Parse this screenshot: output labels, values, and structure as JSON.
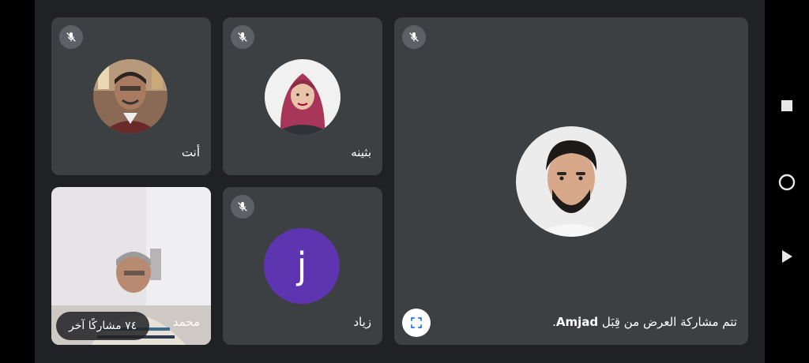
{
  "tiles": {
    "you": {
      "name": "أنت",
      "muted": true
    },
    "bothaina": {
      "name": "بثينه",
      "muted": true
    },
    "amjad": {
      "presenter": "Amjad",
      "presenting_text": "تتم مشاركة العرض من قِبَل",
      "muted": true
    },
    "mohammed": {
      "name": "محمد",
      "others": "٧٤ مشاركًا آخر"
    },
    "ziad": {
      "name": "زياد",
      "initial": "j",
      "avatar_color": "#5e35b1",
      "muted": true
    }
  },
  "icons": {
    "mic_off": "mic-off-icon",
    "fullscreen": "fullscreen-icon",
    "nav_recents": "square-icon",
    "nav_home": "circle-icon",
    "nav_back": "triangle-icon"
  }
}
